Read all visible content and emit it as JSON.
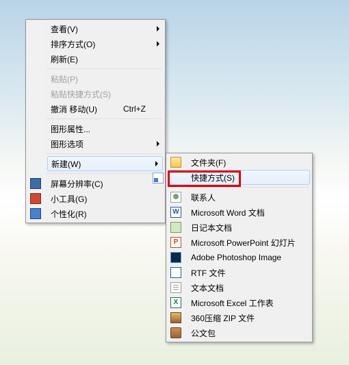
{
  "primary_menu": {
    "view": "查看(V)",
    "sort": "排序方式(O)",
    "refresh": "刷新(E)",
    "paste": "粘贴(P)",
    "paste_shortcut": "粘贴快捷方式(S)",
    "undo_move": "撤消 移动(U)",
    "undo_shortcut": "Ctrl+Z",
    "graphics_props": "图形属性...",
    "graphics_opts": "图形选项",
    "new": "新建(W)",
    "resolution": "屏幕分辨率(C)",
    "gadgets": "小工具(G)",
    "personalize": "个性化(R)"
  },
  "secondary_menu": {
    "folder": "文件夹(F)",
    "shortcut": "快捷方式(S)",
    "contact": "联系人",
    "word": "Microsoft Word 文档",
    "diary": "日记本文档",
    "ppt": "Microsoft PowerPoint 幻灯片",
    "psd": "Adobe Photoshop Image",
    "rtf": "RTF 文件",
    "txt": "文本文档",
    "xls": "Microsoft Excel 工作表",
    "zip": "360压缩 ZIP 文件",
    "briefcase": "公文包"
  }
}
